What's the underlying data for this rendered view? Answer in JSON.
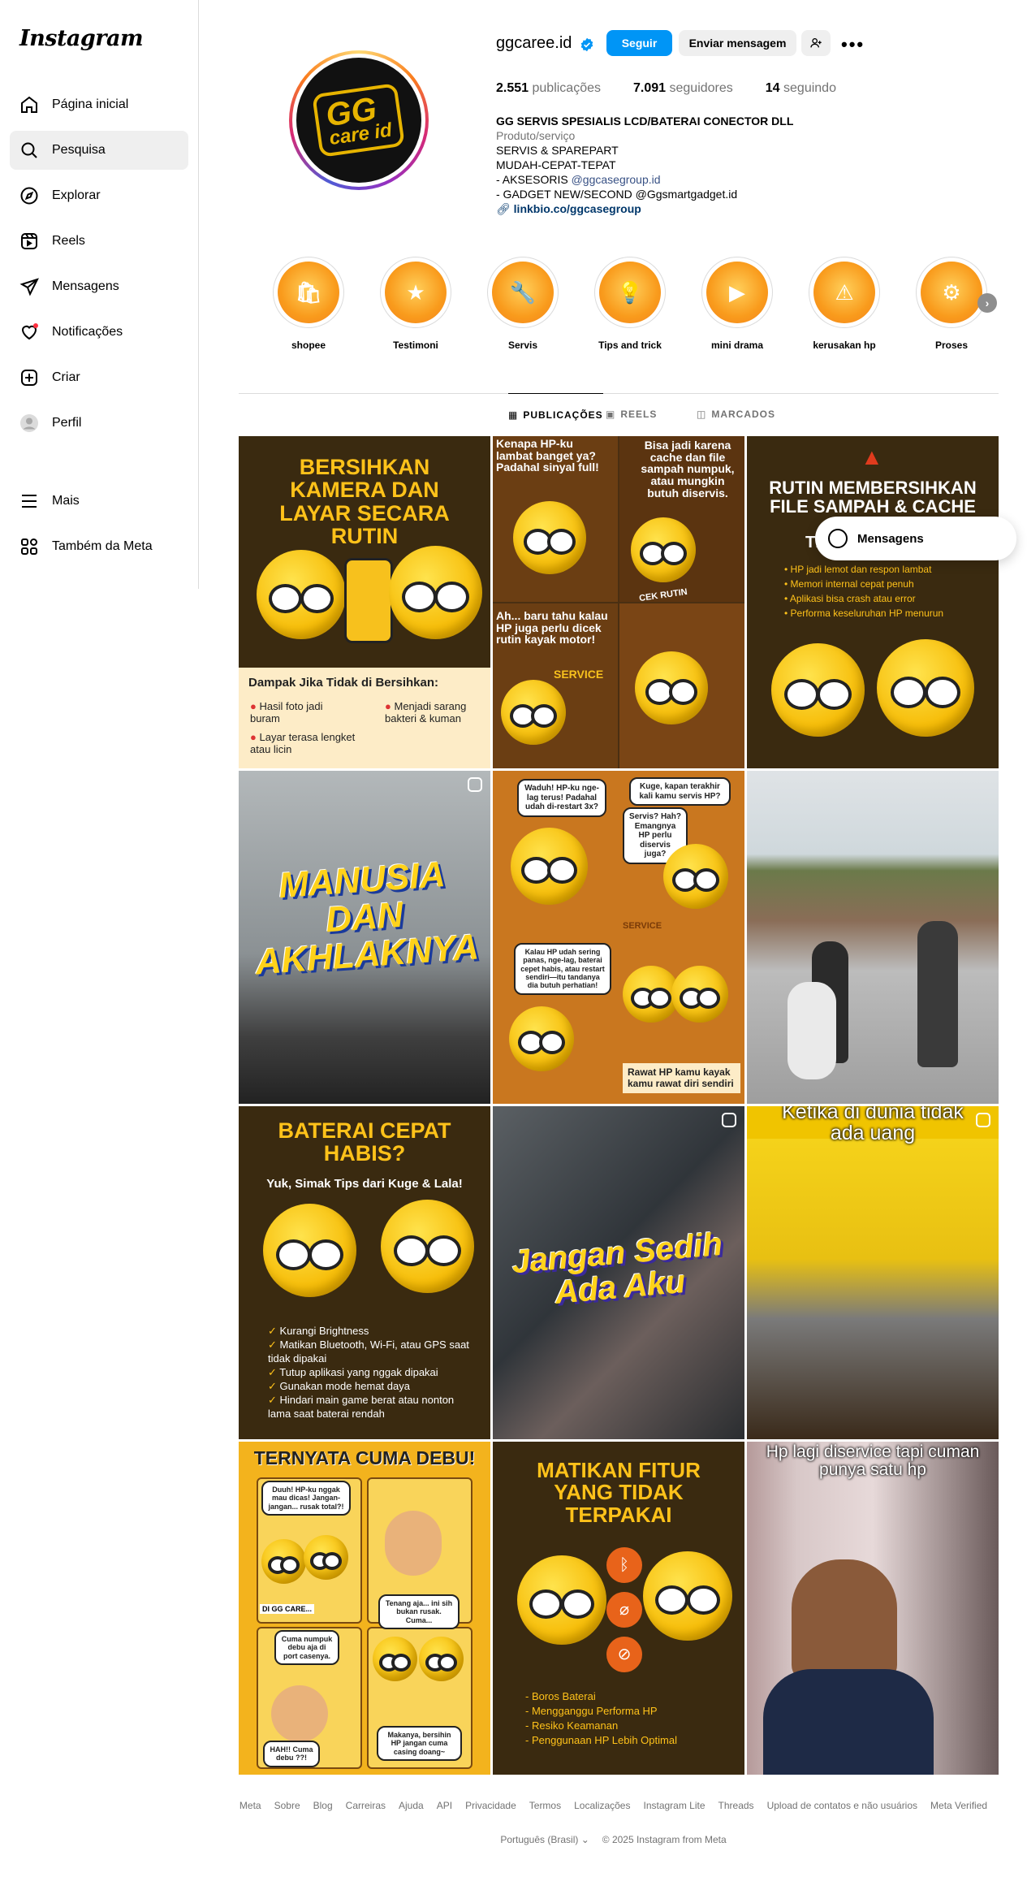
{
  "app": {
    "logo_text": "Instagram"
  },
  "sidebar": {
    "items": [
      {
        "label": "Página inicial",
        "icon": "home-icon"
      },
      {
        "label": "Pesquisa",
        "icon": "search-icon"
      },
      {
        "label": "Explorar",
        "icon": "compass-icon"
      },
      {
        "label": "Reels",
        "icon": "reels-icon"
      },
      {
        "label": "Mensagens",
        "icon": "send-icon"
      },
      {
        "label": "Notificações",
        "icon": "heart-icon"
      },
      {
        "label": "Criar",
        "icon": "plus-square-icon"
      },
      {
        "label": "Perfil",
        "icon": "avatar-icon"
      }
    ],
    "bottom_items": [
      {
        "label": "Mais",
        "icon": "menu-icon"
      },
      {
        "label": "Também da Meta",
        "icon": "meta-apps-icon"
      }
    ],
    "active_index": 1
  },
  "profile": {
    "username": "ggcaree.id",
    "verified": true,
    "avatar_text": "GG",
    "avatar_subtext": "care id",
    "follow_label": "Seguir",
    "message_label": "Enviar mensagem",
    "stats": {
      "posts": "2.551",
      "posts_label": "publicações",
      "followers": "7.091",
      "followers_label": "seguidores",
      "following": "14",
      "following_label": "seguindo"
    },
    "bio": {
      "name": "GG SERVIS SPESIALIS LCD/BATERAI CONECTOR DLL",
      "category": "Produto/serviço",
      "line1": "SERVIS & SPAREPART",
      "line2": "MUDAH-CEPAT-TEPAT",
      "line3_prefix": "- AKSESORIS ",
      "line3_handle": "@ggcasegroup.id",
      "line4": "- GADGET NEW/SECOND @Ggsmartgadget.id",
      "link": "linkbio.co/ggcasegroup"
    }
  },
  "highlights": [
    {
      "label": "shopee",
      "icon": "🛍"
    },
    {
      "label": "Testimoni",
      "icon": "★"
    },
    {
      "label": "Servis",
      "icon": "🔧"
    },
    {
      "label": "Tips and trick",
      "icon": "💡"
    },
    {
      "label": "mini drama",
      "icon": "▶"
    },
    {
      "label": "kerusakan hp",
      "icon": "⚠"
    },
    {
      "label": "Proses",
      "icon": "⚙"
    }
  ],
  "tabs": [
    {
      "label": "PUBLICAÇÕES",
      "icon": "▦",
      "active": true
    },
    {
      "label": "REELS",
      "icon": "▣",
      "active": false
    },
    {
      "label": "MARCADOS",
      "icon": "◫",
      "active": false
    }
  ],
  "posts": [
    {
      "title": "BERSIHKAN KAMERA DAN LAYAR SECARA RUTIN",
      "panel_title": "Dampak Jika Tidak di Bersihkan:",
      "items": [
        "Hasil foto jadi buram",
        "Menjadi sarang bakteri & kuman",
        "Layar terasa lengket atau licin"
      ]
    },
    {
      "bubbles": [
        "Kenapa HP-ku lambat banget ya? Padahal sinyal full!",
        "Bisa jadi karena cache dan file sampah numpuk, atau mungkin butuh diservis.",
        "Ah... baru tahu kalau HP juga perlu dicek rutin kayak motor!",
        "CEK RUTIN",
        "SERVICE"
      ]
    },
    {
      "title": "RUTIN MEMBERSIHKAN FILE SAMPAH & CACHE",
      "subtitle": "TI",
      "items": [
        "HP jadi lemot dan respon lambat",
        "Memori internal cepat penuh",
        "Aplikasi bisa crash atau error",
        "Performa keseluruhan HP menurun"
      ]
    },
    {
      "title": "MANUSIA DAN AKHLAKNYA",
      "reel": true
    },
    {
      "bubbles": [
        "Waduh! HP-ku nge-lag terus! Padahal udah di-restart 3x?",
        "Kuge, kapan terakhir kali kamu servis HP?",
        "Servis? Hah? Emangnya HP perlu diservis juga?",
        "Kalau HP udah sering panas, nge-lag, baterai cepet habis, atau restart sendiri—itu tandanya dia butuh perhatian!",
        "Rawat HP kamu kayak kamu rawat diri sendiri",
        "SERVICE"
      ]
    },
    {
      "scene": "street"
    },
    {
      "title": "BATERAI CEPAT HABIS?",
      "subtitle": "Yuk, Simak Tips dari Kuge & Lala!",
      "items": [
        "Kurangi Brightness",
        "Matikan Bluetooth, Wi-Fi, atau GPS saat tidak dipakai",
        "Tutup aplikasi yang nggak dipakai",
        "Gunakan mode hemat daya",
        "Hindari main game berat atau nonton lama saat baterai rendah"
      ]
    },
    {
      "title": "Jangan Sedih Ada Aku",
      "reel": true
    },
    {
      "caption": "Ketika di dunia tidak ada uang",
      "reel": true
    },
    {
      "title": "TERNYATA CUMA DEBU!",
      "bubbles": [
        "Duuh! HP-ku nggak mau dicas! Jangan-jangan... rusak total?!",
        "DI GG CARE...",
        "Tenang aja... ini sih bukan rusak. Cuma...",
        "Cuma numpuk debu aja di port casenya.",
        "HAH!! Cuma debu ??!",
        "Makanya, bersihin HP jangan cuma casing doang~"
      ]
    },
    {
      "title": "MATIKAN FITUR YANG TIDAK TERPAKAI",
      "items": [
        "Boros Baterai",
        "Mengganggu Performa HP",
        "Resiko Keamanan",
        "Penggunaan HP Lebih Optimal"
      ]
    },
    {
      "caption": "Hp lagi diservice tapi cuman punya satu hp"
    }
  ],
  "floating_messages": {
    "label": "Mensagens"
  },
  "footer": {
    "links": [
      "Meta",
      "Sobre",
      "Blog",
      "Carreiras",
      "Ajuda",
      "API",
      "Privacidade",
      "Termos",
      "Localizações",
      "Instagram Lite",
      "Threads",
      "Upload de contatos e não usuários",
      "Meta Verified"
    ],
    "language": "Português (Brasil)",
    "copyright": "© 2025 Instagram from Meta"
  }
}
